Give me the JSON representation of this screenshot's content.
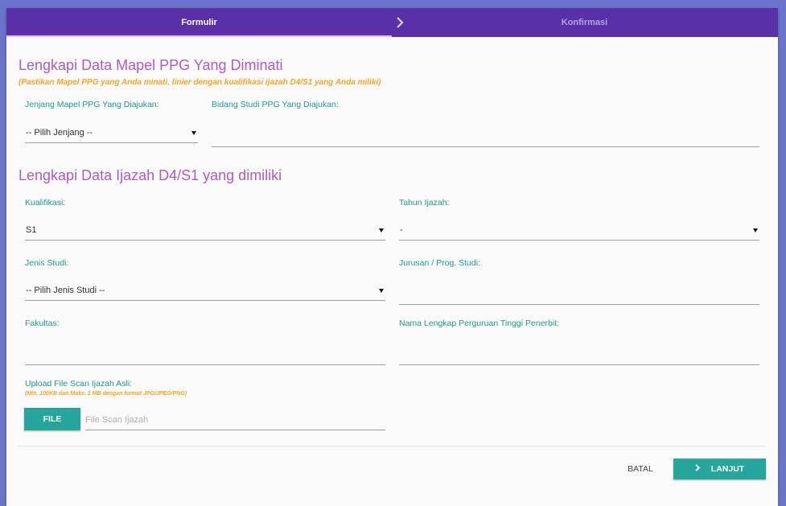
{
  "steps": {
    "formulir": "Formulir",
    "konfirmasi": "Konfirmasi"
  },
  "mapel": {
    "title": "Lengkapi Data Mapel PPG Yang Diminati",
    "note": "(Pastikan Mapel PPG yang Anda minati, linier dengan kualifikasi ijazah D4/S1 yang Anda miliki)",
    "jenjang_label": "Jenjang Mapel PPG Yang Diajukan:",
    "jenjang_value": "-- Pilih Jenjang --",
    "bidang_label": "Bidang Studi PPG Yang Diajukan:",
    "bidang_value": ""
  },
  "ijazah": {
    "title": "Lengkapi Data Ijazah D4/S1 yang dimiliki",
    "kualifikasi_label": "Kualifikasi:",
    "kualifikasi_value": "S1",
    "tahun_label": "Tahun Ijazah:",
    "tahun_value": "-",
    "jenis_label": "Jenis Studi:",
    "jenis_value": "-- Pilih Jenis Studi --",
    "jurusan_label": "Jurusan / Prog. Studi:",
    "jurusan_value": "",
    "fakultas_label": "Fakultas:",
    "fakultas_value": "",
    "pt_label": "Nama Lengkap Perguruan Tinggi Penerbit:",
    "pt_value": ""
  },
  "upload": {
    "label": "Upload File Scan Ijazah Asli:",
    "note": "(Min. 100KB dan Maks. 1 MB dengan format JPG/JPEG/PNG)",
    "button": "FILE",
    "placeholder": "File Scan Ijazah"
  },
  "actions": {
    "cancel": "BATAL",
    "next": "LANJUT"
  },
  "colors": {
    "header": "#5a30a8",
    "accent": "#26a69a",
    "title": "#b05ac4",
    "note": "#f7a622",
    "label": "#1c9c8c"
  },
  "icons": {
    "step_arrow": "chevron-right-icon",
    "next": "chevron-right-icon",
    "dropdown": "caret-down-icon"
  }
}
